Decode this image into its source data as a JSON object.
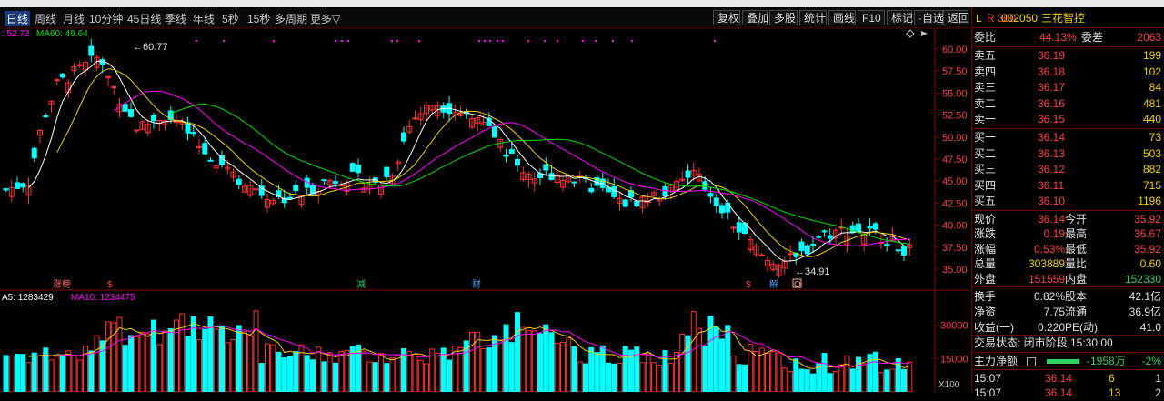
{
  "toolbar": {
    "periods": [
      "日线",
      "周线",
      "月线",
      "10分钟",
      "45日线",
      "季线",
      "年线",
      "5秒",
      "15秒",
      "多周期",
      "更多▽"
    ],
    "active_period": "日线",
    "tools": [
      "复权",
      "叠加",
      "多股",
      "统计",
      "画线",
      "F10",
      "标记",
      "·自选",
      "返回"
    ]
  },
  "ma_legend": {
    "ma30": ": 52.72",
    "ma60": "MA60: 49.64"
  },
  "vol_legend": {
    "ma5": "A5: 1283429",
    "ma10": "MA10: 1234475"
  },
  "price_axis": [
    "60.00",
    "57.50",
    "55.00",
    "52.50",
    "50.00",
    "47.50",
    "45.00",
    "42.50",
    "40.00",
    "37.50",
    "35.00"
  ],
  "vol_axis": [
    "30000",
    "15000"
  ],
  "vol_unit": "X100",
  "annotations": {
    "high": "60.77",
    "low": "34.91"
  },
  "event_tags": [
    "涨榜",
    "$",
    "减",
    "财",
    "$",
    "解",
    "O"
  ],
  "quote": {
    "code": "002050",
    "name": "三花智控",
    "prefix": "L",
    "market_tag": "R 300",
    "weibi_label": "委比",
    "weibi_value": "44.13%",
    "weicha_label": "委差",
    "weicha_value": "2063",
    "asks": [
      {
        "label": "卖五",
        "price": "36.19",
        "vol": "199"
      },
      {
        "label": "卖四",
        "price": "36.18",
        "vol": "102"
      },
      {
        "label": "卖三",
        "price": "36.17",
        "vol": "84"
      },
      {
        "label": "卖二",
        "price": "36.16",
        "vol": "481"
      },
      {
        "label": "卖一",
        "price": "36.15",
        "vol": "440"
      }
    ],
    "bids": [
      {
        "label": "买一",
        "price": "36.14",
        "vol": "73"
      },
      {
        "label": "买二",
        "price": "36.13",
        "vol": "503"
      },
      {
        "label": "买三",
        "price": "36.12",
        "vol": "882"
      },
      {
        "label": "买四",
        "price": "36.11",
        "vol": "715"
      },
      {
        "label": "买五",
        "price": "36.10",
        "vol": "1196"
      }
    ],
    "stats": [
      {
        "l1": "现价",
        "v1": "36.14",
        "l2": "今开",
        "v2": "35.92",
        "c1": "red",
        "c2": "red"
      },
      {
        "l1": "涨跌",
        "v1": "0.19",
        "l2": "最高",
        "v2": "36.67",
        "c1": "red",
        "c2": "red"
      },
      {
        "l1": "涨幅",
        "v1": "0.53%",
        "l2": "最低",
        "v2": "35.92",
        "c1": "red",
        "c2": "red"
      },
      {
        "l1": "总量",
        "v1": "303889",
        "l2": "量比",
        "v2": "0.60",
        "c1": "yel",
        "c2": "yel"
      },
      {
        "l1": "外盘",
        "v1": "151559",
        "l2": "内盘",
        "v2": "152330",
        "c1": "red",
        "c2": "grn"
      }
    ],
    "fund": [
      {
        "l1": "换手",
        "v1": "0.82%",
        "l2": "股本",
        "v2": "42.1亿"
      },
      {
        "l1": "净资",
        "v1": "7.75",
        "l2": "流通",
        "v2": "36.9亿"
      },
      {
        "l1": "收益(一)",
        "v1": "0.220",
        "l2": "PE(动)",
        "v2": "41.0"
      }
    ],
    "trade_status": "交易状态: 闭市阶段 15:30:00",
    "main_flow_label": "主力净额",
    "main_flow_value": "-1958万",
    "main_flow_pct": "-2%",
    "ticks": [
      {
        "time": "15:07",
        "price": "36.14",
        "vol": "6",
        "num": "1"
      },
      {
        "time": "15:07",
        "price": "36.14",
        "vol": "13",
        "num": "2"
      }
    ]
  },
  "colors": {
    "up": "#ff3030",
    "down": "#00ffff",
    "ma5": "#ffffff",
    "ma10": "#f0d000",
    "ma20": "#ff00ff",
    "ma60": "#00e000"
  }
}
